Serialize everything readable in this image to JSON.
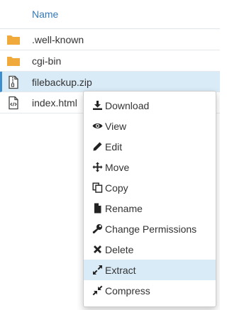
{
  "table": {
    "header": {
      "name_label": "Name"
    },
    "rows": [
      {
        "name": ".well-known",
        "icon": "folder-icon",
        "selected": false
      },
      {
        "name": "cgi-bin",
        "icon": "folder-icon",
        "selected": false
      },
      {
        "name": "filebackup.zip",
        "icon": "zip-file-icon",
        "selected": true
      },
      {
        "name": "index.html",
        "icon": "html-file-icon",
        "selected": false
      }
    ]
  },
  "context_menu": {
    "items": [
      {
        "label": "Download",
        "icon": "download-icon"
      },
      {
        "label": "View",
        "icon": "eye-icon"
      },
      {
        "label": "Edit",
        "icon": "pencil-icon"
      },
      {
        "label": "Move",
        "icon": "move-arrows-icon"
      },
      {
        "label": "Copy",
        "icon": "copy-icon"
      },
      {
        "label": "Rename",
        "icon": "file-icon"
      },
      {
        "label": "Change Permissions",
        "icon": "wrench-icon"
      },
      {
        "label": "Delete",
        "icon": "x-icon"
      },
      {
        "label": "Extract",
        "icon": "expand-icon",
        "highlighted": true
      },
      {
        "label": "Compress",
        "icon": "compress-icon"
      }
    ]
  },
  "colors": {
    "header_link": "#3379b7",
    "folder": "#f0a93b",
    "selection": "#d9ebf7",
    "selection_border": "#3b8fd0"
  }
}
